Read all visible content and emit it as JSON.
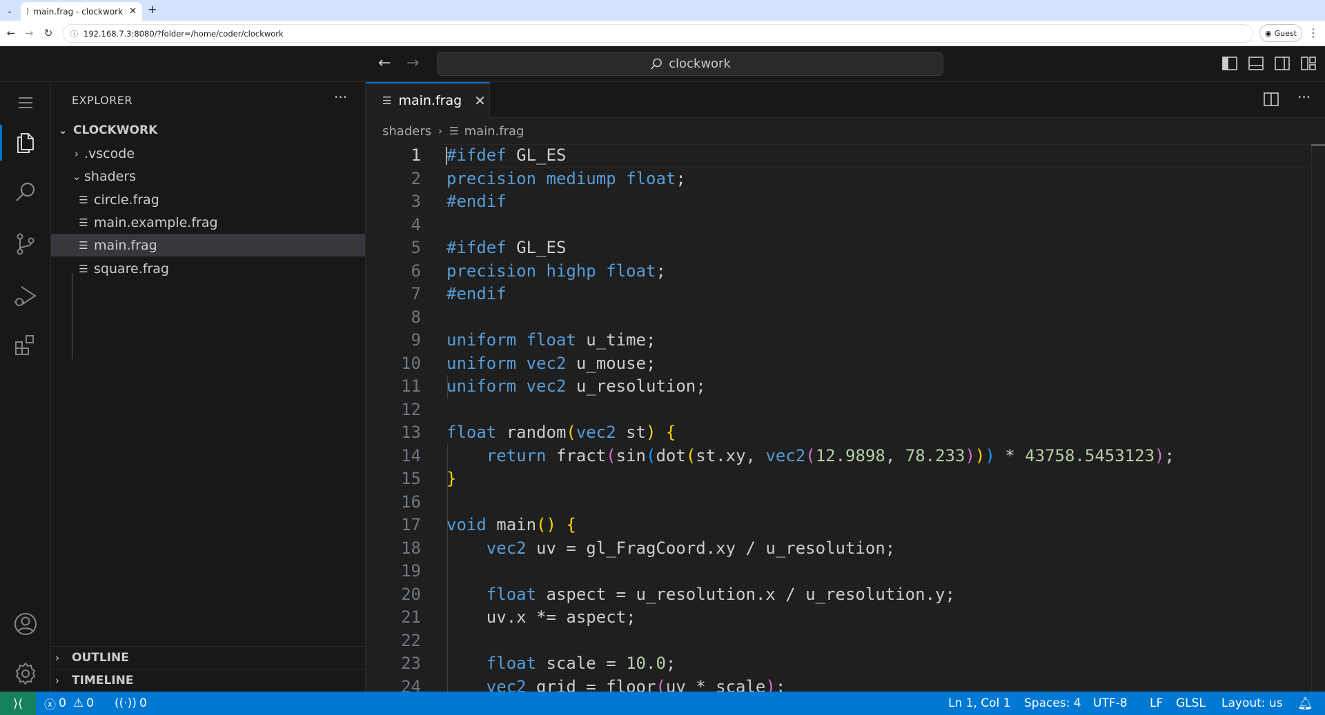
{
  "browser": {
    "tab_title": "main.frag - clockwork - c",
    "tab_close": "✕",
    "new_tab": "+",
    "url": "192.168.7.3:8080/?folder=/home/coder/clockwork",
    "profile_label": "Guest"
  },
  "titlebar": {
    "search_text": "clockwork"
  },
  "sidebar": {
    "title": "EXPLORER",
    "more": "···",
    "root_folder": "CLOCKWORK",
    "tree": [
      {
        "label": ".vscode",
        "type": "folder",
        "expanded": false
      },
      {
        "label": "shaders",
        "type": "folder",
        "expanded": true
      },
      {
        "label": "circle.frag",
        "type": "file"
      },
      {
        "label": "main.example.frag",
        "type": "file"
      },
      {
        "label": "main.frag",
        "type": "file",
        "selected": true
      },
      {
        "label": "square.frag",
        "type": "file"
      }
    ],
    "outline_label": "OUTLINE",
    "timeline_label": "TIMELINE"
  },
  "editor": {
    "tab_label": "main.frag",
    "breadcrumb_folder": "shaders",
    "breadcrumb_file": "main.frag",
    "more": "···",
    "line_numbers": [
      "1",
      "2",
      "3",
      "4",
      "5",
      "6",
      "7",
      "8",
      "9",
      "10",
      "11",
      "12",
      "13",
      "14",
      "15",
      "16",
      "17",
      "18",
      "19",
      "20",
      "21",
      "22",
      "23",
      "24"
    ],
    "active_line": "1"
  },
  "statusbar": {
    "errors": "0",
    "warnings": "0",
    "ports": "0",
    "cursor_position": "Ln 1, Col 1",
    "indentation": "Spaces: 4",
    "encoding": "UTF-8",
    "eol": "LF",
    "language": "GLSL",
    "layout": "Layout: us"
  },
  "colors": {
    "accent": "#0078d4",
    "remote": "#16825d",
    "editor_bg": "#1f1f1f",
    "sidebar_bg": "#181818",
    "keyword": "#569cd6",
    "function": "#dcdcaa",
    "number": "#b5cea8"
  },
  "icons": [
    "menu-icon",
    "files-icon",
    "search-icon",
    "source-control-icon",
    "run-debug-icon",
    "extensions-icon",
    "account-icon",
    "settings-gear-icon",
    "split-editor-icon",
    "close-icon",
    "remote-icon",
    "error-icon",
    "warning-icon",
    "broadcast-icon",
    "bell-icon"
  ]
}
